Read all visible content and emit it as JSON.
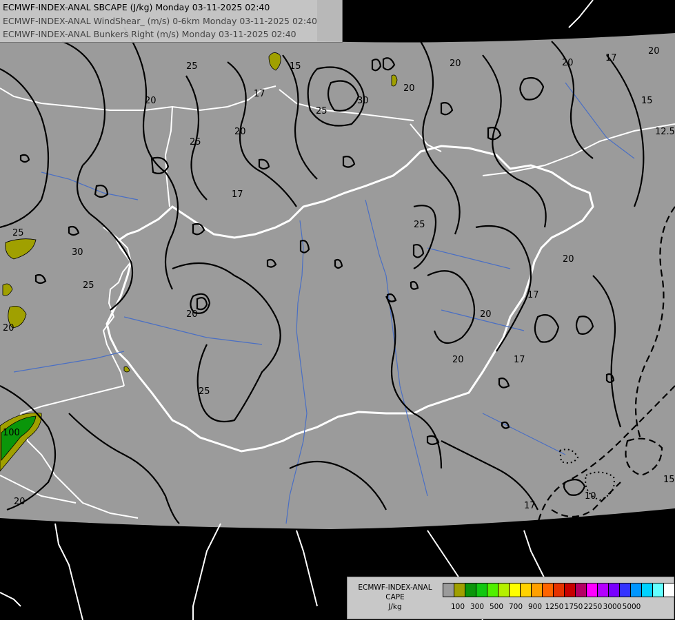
{
  "header": {
    "line1": "ECMWF-INDEX-ANAL SBCAPE (J/kg) Monday 03-11-2025 02:40",
    "line2": "ECMWF-INDEX-ANAL WindShear_ (m/s) 0-6km Monday 03-11-2025 02:40",
    "line3": "ECMWF-INDEX-ANAL Bunkers Right (m/s) Monday 03-11-2025 02:40"
  },
  "legend": {
    "title_line1": "ECMWF-INDEX-ANAL",
    "title_line2": "CAPE",
    "title_line3": "J/kg",
    "colors": [
      "#9b9b9b",
      "#a0a000",
      "#0a960a",
      "#10c810",
      "#50f000",
      "#b4f000",
      "#ffff00",
      "#ffd200",
      "#ffa000",
      "#ff6400",
      "#e63200",
      "#c80000",
      "#b40064",
      "#ff00ff",
      "#b400ff",
      "#7800ff",
      "#3232ff",
      "#0096ff",
      "#00d2ff",
      "#64ffff",
      "#ffffff"
    ],
    "ticks": [
      "100",
      "300",
      "500",
      "700",
      "900",
      "1250",
      "1750",
      "2250",
      "3000",
      "5000"
    ]
  },
  "contour_labels": [
    "25",
    "20",
    "15",
    "30",
    "20",
    "17",
    "20",
    "25",
    "20",
    "17",
    "15",
    "12.5",
    "20",
    "25",
    "25",
    "30",
    "25",
    "17",
    "20",
    "20",
    "20",
    "20",
    "17",
    "17",
    "100",
    "20",
    "20",
    "25",
    "20",
    "25",
    "17",
    "10",
    "15"
  ],
  "colors": {
    "background": "#000000",
    "domain": "#9b9b9b",
    "borders": "#ffffff",
    "rivers": "#4a6fc4",
    "contours": "#000000"
  }
}
